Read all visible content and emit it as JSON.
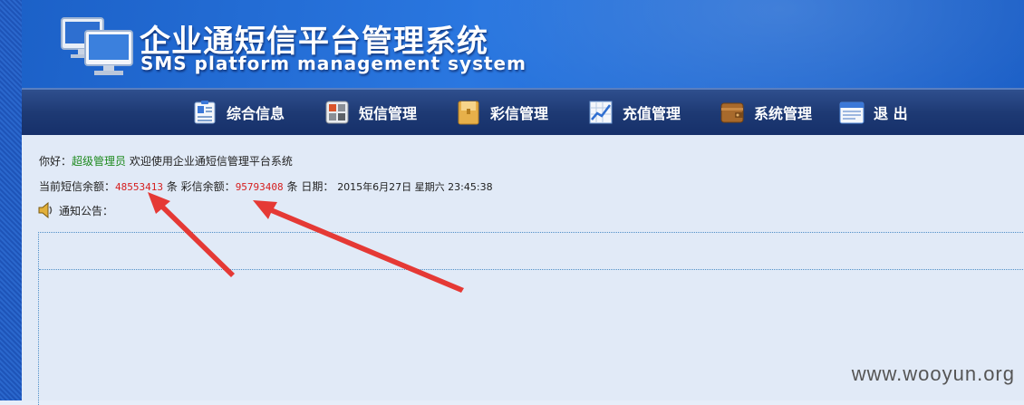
{
  "header": {
    "title": "企业通短信平台管理系统",
    "subtitle": "SMS platform management system"
  },
  "nav": {
    "items": [
      {
        "label": "综合信息",
        "icon": "profile-card-icon"
      },
      {
        "label": "短信管理",
        "icon": "grid-tiles-icon"
      },
      {
        "label": "彩信管理",
        "icon": "folder-icon"
      },
      {
        "label": "充值管理",
        "icon": "chart-icon"
      },
      {
        "label": "系统管理",
        "icon": "wallet-icon"
      },
      {
        "label": "退 出",
        "icon": "window-icon"
      }
    ]
  },
  "welcome": {
    "greeting": "你好：",
    "user": "超级管理员",
    "message": "欢迎使用企业通短信管理平台系统"
  },
  "balance": {
    "sms_label": "当前短信余额：",
    "sms_value": "48553413",
    "sms_unit": "条",
    "mms_label": "彩信余额：",
    "mms_value": "95793408",
    "mms_unit": "条",
    "date_label": "日期：",
    "date_value": "2015年6月27日 星期六 23:45:38"
  },
  "notice": {
    "label": "通知公告："
  },
  "watermark": "www.wooyun.org",
  "colors": {
    "header_blue": "#2a77e0",
    "nav_dark": "#1e3a74",
    "content_bg": "#e1eaf7",
    "highlight_red": "#d62020",
    "admin_green": "#1e8a1e",
    "arrow_red": "#e53935"
  }
}
